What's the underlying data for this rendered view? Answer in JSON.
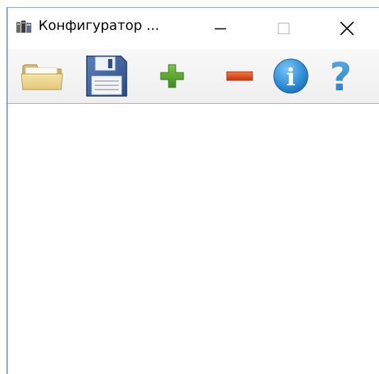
{
  "window": {
    "title": "Конфигуратор ..."
  },
  "toolbar": {
    "items": [
      {
        "icon": "open-folder-icon"
      },
      {
        "icon": "floppy-disk-icon"
      },
      {
        "icon": "plus-icon"
      },
      {
        "icon": "minus-icon"
      },
      {
        "icon": "info-icon"
      },
      {
        "icon": "question-mark-icon"
      }
    ]
  },
  "help_glyph": "?",
  "info_glyph": "i",
  "colors": {
    "window_border": "#7aa6d8",
    "plus_green": "#4e9a2a",
    "minus_red": "#d6471e",
    "info_blue": "#2e8fd6",
    "help_blue": "#3a8fd0",
    "folder_yellow": "#e9d28a",
    "floppy_blue": "#3a5e98"
  }
}
